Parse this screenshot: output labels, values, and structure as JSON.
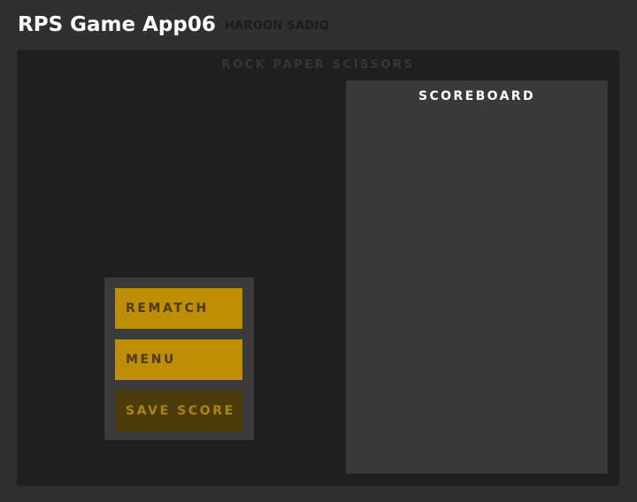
{
  "header": {
    "title": "RPS Game App06",
    "author": "HAROON SADIQ"
  },
  "game": {
    "title": "ROCK PAPER SCISSORS"
  },
  "scoreboard": {
    "title": "SCOREBOARD"
  },
  "menu": {
    "rematch_label": "REMATCH",
    "menu_label": "MENU",
    "save_label": "SAVE SCORE"
  },
  "colors": {
    "page_background": "#303030",
    "panel_background": "#1f1f1f",
    "scoreboard_background": "#393939",
    "button_gold": "#be8e05",
    "button_disabled": "#4c3b0b"
  }
}
